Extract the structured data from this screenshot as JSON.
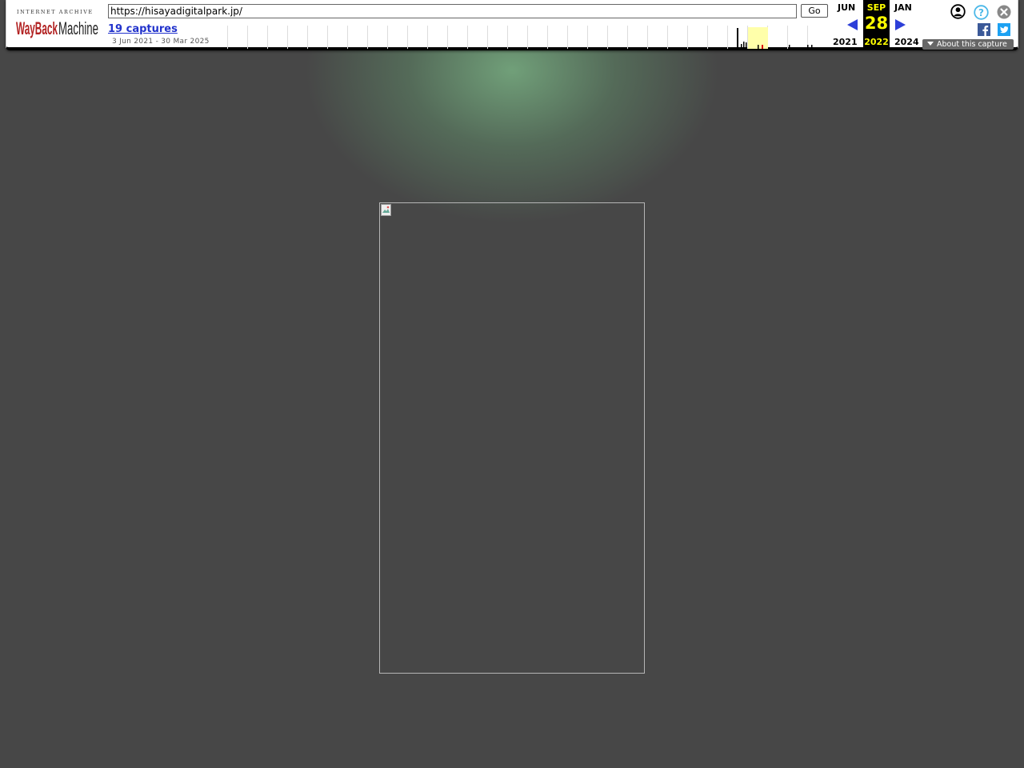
{
  "toolbar": {
    "logo_top_text": "INTERNET ARCHIVE",
    "logo_brand": "WayBackMachine",
    "url_value": "https://hisayadigitalpark.jp/",
    "go_label": "Go",
    "captures_label": "19 captures",
    "date_range": "3 Jun 2021 - 30 Mar 2025",
    "calendar": {
      "prev_month": "JUN",
      "prev_year": "2021",
      "current_month": "SEP",
      "current_day": "28",
      "current_year": "2022",
      "next_month": "JAN",
      "next_year": "2024"
    },
    "about_label": "About this capture",
    "icons": [
      "user-icon",
      "help-icon",
      "close-icon",
      "facebook-icon",
      "twitter-icon"
    ],
    "colors": {
      "accent_blue": "#2d3fd8",
      "highlight_yellow": "#ffff00",
      "logo_red": "#b22222"
    }
  },
  "page": {
    "background": "#474747",
    "image_alt": ""
  }
}
